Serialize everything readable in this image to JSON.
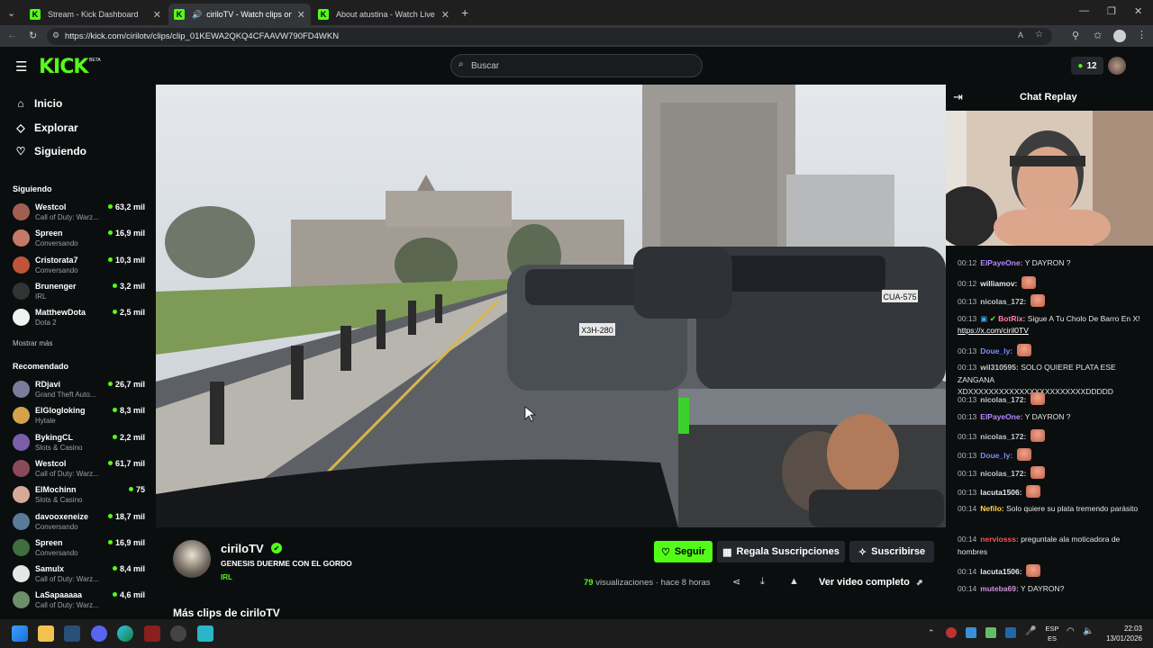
{
  "browser": {
    "tabs": [
      {
        "label": "Stream - Kick Dashboard",
        "active": false
      },
      {
        "label": "ciriloTV - Watch clips on Kick",
        "active": true
      },
      {
        "label": "About atustina - Watch Live on Ki",
        "active": false
      }
    ],
    "url": "https://kick.com/cirilotv/clips/clip_01KEWA2QKQ4CFAAVW790FD4WKN",
    "new_tab_icon": "plus-icon"
  },
  "header": {
    "logo": "KICK",
    "logo_badge": "BETA",
    "search_placeholder": "Buscar",
    "credits": "12"
  },
  "sidebar": {
    "nav": [
      {
        "label": "Inicio",
        "icon": "home-icon"
      },
      {
        "label": "Explorar",
        "icon": "compass-icon"
      },
      {
        "label": "Siguiendo",
        "icon": "heart-icon"
      }
    ],
    "following_title": "Siguiendo",
    "following": [
      {
        "name": "Westcol",
        "category": "Call of Duty: Warz...",
        "viewers": "63,2 mil"
      },
      {
        "name": "Spreen",
        "category": "Conversando",
        "viewers": "16,9 mil"
      },
      {
        "name": "Cristorata7",
        "category": "Conversando",
        "viewers": "10,3 mil"
      },
      {
        "name": "Brunenger",
        "category": "IRL",
        "viewers": "3,2 mil"
      },
      {
        "name": "MatthewDota",
        "category": "Dota 2",
        "viewers": "2,5 mil"
      }
    ],
    "show_more": "Mostrar más",
    "recommended_title": "Recomendado",
    "recommended": [
      {
        "name": "RDjavi",
        "category": "Grand Theft Auto...",
        "viewers": "26,7 mil"
      },
      {
        "name": "ElGlogloking",
        "category": "Hytale",
        "viewers": "8,3 mil"
      },
      {
        "name": "BykingCL",
        "category": "Slots & Casino",
        "viewers": "2,2 mil"
      },
      {
        "name": "Westcol",
        "category": "Call of Duty: Warz...",
        "viewers": "61,7 mil"
      },
      {
        "name": "ElMochinn",
        "category": "Slots & Casino",
        "viewers": "75"
      },
      {
        "name": "davooxeneize",
        "category": "Conversando",
        "viewers": "18,7 mil"
      },
      {
        "name": "Spreen",
        "category": "Conversando",
        "viewers": "16,9 mil"
      },
      {
        "name": "Samulx",
        "category": "Call of Duty: Warz...",
        "viewers": "8,4 mil"
      },
      {
        "name": "LaSapaaaaa",
        "category": "Call of Duty: Warz...",
        "viewers": "4,6 mil"
      }
    ]
  },
  "video": {
    "plate_front": "X3H-280",
    "plate_right": "CUA-575"
  },
  "clip": {
    "channel": "ciriloTV",
    "title": "GENESIS DUERME CON EL GORDO",
    "category": "IRL",
    "follow_label": "Seguir",
    "gift_label": "Regala Suscripciones",
    "subscribe_label": "Suscribirse",
    "views_count": "79",
    "views_label": "visualizaciones",
    "age": "· hace 8 horas",
    "full_video_label": "Ver video completo",
    "more_clips": "Más clips de ciriloTV"
  },
  "chat": {
    "title": "Chat Replay",
    "messages": [
      {
        "time": "00:12",
        "user": "ElPayeOne:",
        "color": "#b388ff",
        "text": "Y DAYRON ?",
        "emote": false
      },
      {
        "time": "00:12",
        "user": "williamov:",
        "color": "#e6e6e6",
        "text": "",
        "emote": true
      },
      {
        "time": "00:13",
        "user": "nicolas_172:",
        "color": "#c8c8c8",
        "text": "",
        "emote": true
      },
      {
        "time": "00:13",
        "user": "BotRix:",
        "color": "#ff80ab",
        "text": "Sigue A Tu Cholo De Barro En X!",
        "link": "https://x.com/ciril0TV",
        "emote": false
      },
      {
        "time": "00:13",
        "user": "Doue_ly:",
        "color": "#7c8cff",
        "text": "",
        "emote": true
      },
      {
        "time": "00:13",
        "user": "wil310595:",
        "color": "#c8c8c8",
        "text": "SOLO QUIERE PLATA ESE ZANGANA XDXXXXXXXXXXXXXXXXXXXXXXXDDDDD",
        "emote": false
      },
      {
        "time": "00:13",
        "user": "nicolas_172:",
        "color": "#c8c8c8",
        "text": "",
        "emote": true
      },
      {
        "time": "00:13",
        "user": "ElPayeOne:",
        "color": "#b388ff",
        "text": "Y DAYRON ?",
        "emote": false
      },
      {
        "time": "00:13",
        "user": "nicolas_172:",
        "color": "#c8c8c8",
        "text": "",
        "emote": true
      },
      {
        "time": "00:13",
        "user": "Doue_ly:",
        "color": "#7c8cff",
        "text": "",
        "emote": true
      },
      {
        "time": "00:13",
        "user": "nicolas_172:",
        "color": "#c8c8c8",
        "text": "",
        "emote": true
      },
      {
        "time": "00:13",
        "user": "lacuta1506:",
        "color": "#e6e6e6",
        "text": "",
        "emote": true
      },
      {
        "time": "00:14",
        "user": "Nefilo:",
        "color": "#ffd54f",
        "text": "Solo quiere su plata tremendo parásito",
        "emote": false
      },
      {
        "time": "00:14",
        "user": "nerviosss:",
        "color": "#ff5252",
        "text": "preguntale ala moticadora de hombres",
        "emote": false
      },
      {
        "time": "00:14",
        "user": "lacuta1506:",
        "color": "#e6e6e6",
        "text": "",
        "emote": true
      },
      {
        "time": "00:14",
        "user": "muteba69:",
        "color": "#ce93d8",
        "text": "Y DAYRON?",
        "emote": false
      }
    ]
  },
  "taskbar": {
    "lang_top": "ESP",
    "lang_bottom": "ES",
    "time": "22:03",
    "date": "13/01/2026"
  },
  "colors": {
    "kick_green": "#53fc18",
    "background": "#0b0e0f",
    "panel": "#24272c"
  }
}
